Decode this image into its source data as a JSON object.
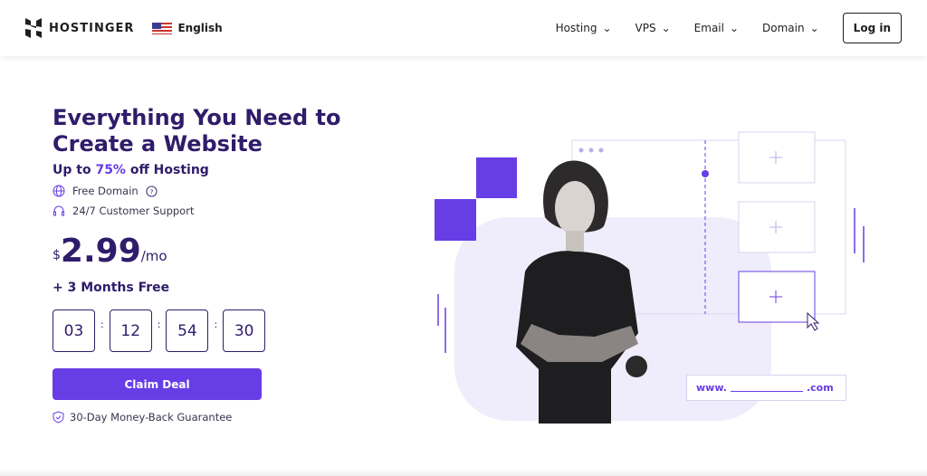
{
  "header": {
    "brand": "HOSTINGER",
    "language": "English",
    "nav": [
      {
        "label": "Hosting"
      },
      {
        "label": "VPS"
      },
      {
        "label": "Email"
      },
      {
        "label": "Domain"
      }
    ],
    "login": "Log in"
  },
  "hero": {
    "title_line1": "Everything You Need to",
    "title_line2": "Create a Website",
    "subtitle_prefix": "Up to ",
    "subtitle_highlight": "75%",
    "subtitle_suffix": " off Hosting",
    "features": [
      {
        "label": "Free Domain",
        "icon": "globe-icon"
      },
      {
        "label": "24/7 Customer Support",
        "icon": "headset-icon"
      }
    ],
    "price": {
      "currency": "$",
      "amount": "2.99",
      "period": "/mo"
    },
    "bonus": "+ 3 Months Free",
    "timer": [
      "03",
      "12",
      "54",
      "30"
    ],
    "cta": "Claim Deal",
    "guarantee": "30-Day Money-Back Guarantee"
  },
  "illustration": {
    "url_prefix": "www.",
    "url_suffix": ".com"
  },
  "colors": {
    "accent": "#673de6",
    "heading": "#2f1c6a",
    "lavender": "#ebe4ff"
  }
}
